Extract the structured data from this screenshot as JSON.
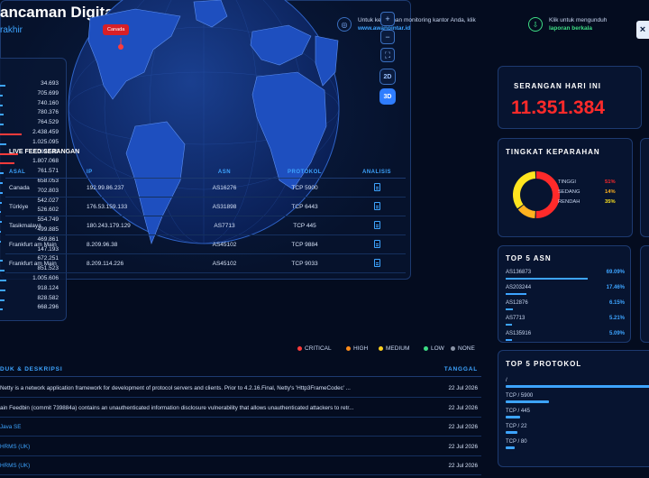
{
  "header": {
    "title": "ancaman Digital di Indonesia",
    "subtitle": "rakhir",
    "info1_text": "Untuk kebutuhan monitoring kantor Anda, klik",
    "info1_link": "www.awanpintar.id",
    "info2_text": "Klik untuk mengunduh",
    "info2_link": "laporan berkala"
  },
  "left_list": {
    "values": [
      "34.693",
      "705.699",
      "740.160",
      "780.376",
      "764.529",
      "2.438.459",
      "1.025.095",
      "2.092.529",
      "1.807.068",
      "761.571",
      "658.053",
      "702.803",
      "542.027",
      "526.602",
      "554.749",
      "499.885",
      "469.861",
      "147.193",
      "672.251",
      "851.523",
      "1.005.606",
      "918.124",
      "828.582",
      "668.296"
    ],
    "bars": [
      0.35,
      0.28,
      0.28,
      0.3,
      0.29,
      0.95,
      0.4,
      0.82,
      0.7,
      0.3,
      0.26,
      0.28,
      0.22,
      0.21,
      0.22,
      0.2,
      0.19,
      0.08,
      0.27,
      0.33,
      0.4,
      0.36,
      0.33,
      0.27
    ]
  },
  "map": {
    "marker_label": "Canada",
    "zoom_in": "+",
    "zoom_out": "−",
    "fullscreen": "⛶",
    "view_2d": "2D",
    "view_3d": "3D"
  },
  "feed": {
    "title": "LIVE FEED SERANGAN",
    "columns": [
      "ASAL",
      "IP",
      "ASN",
      "PROTOKOL",
      "ANALISIS"
    ],
    "rows": [
      [
        "Canada",
        "192.99.86.237",
        "AS16276",
        "TCP 5900"
      ],
      [
        "Türkiye",
        "176.53.159.133",
        "AS31898",
        "TCP 6443"
      ],
      [
        "Tasikmalaya",
        "180.243.179.129",
        "AS7713",
        "TCP 445"
      ],
      [
        "Frankfurt am Main",
        "8.209.96.38",
        "AS45102",
        "TCP 9884"
      ],
      [
        "Frankfurt am Main",
        "8.209.114.226",
        "AS45102",
        "TCP 9033"
      ]
    ]
  },
  "legend": [
    {
      "label": "CRITICAL",
      "color": "#ff3b3b"
    },
    {
      "label": "HIGH",
      "color": "#ff8c1a"
    },
    {
      "label": "MEDIUM",
      "color": "#ffd21f"
    },
    {
      "label": "LOW",
      "color": "#3ddc84"
    },
    {
      "label": "NONE",
      "color": "#8a94a6"
    }
  ],
  "vuln": {
    "col_product": "DUK & DESKRIPSI",
    "col_date": "TANGGAL",
    "rows": [
      {
        "text": "Netty is a network application framework for development of protocol servers and clients. Prior to 4.2.16.Final, Netty's 'Http3FrameCodec' ...",
        "date": "22 Jul 2026",
        "link": false
      },
      {
        "text": "ain    Feedbin (commit 739884a) contains an unauthenticated information disclosure vulnerability that allows unauthenticated attackers to retr...",
        "date": "22 Jul 2026",
        "link": false
      },
      {
        "text": "Java SE",
        "date": "22 Jul 2026",
        "link": true
      },
      {
        "text": "HRMS (UK)",
        "date": "22 Jul 2026",
        "link": true
      },
      {
        "text": "HRMS (UK)",
        "date": "22 Jul 2026",
        "link": true
      }
    ]
  },
  "attack_today": {
    "label": "SERANGAN HARI INI",
    "value": "11.351.384"
  },
  "severity": {
    "title": "TINGKAT KEPARAHAN",
    "items": [
      {
        "label": "TINGGI",
        "pct": "51%",
        "color": "#ff2a2a",
        "value": 51
      },
      {
        "label": "SEDANG",
        "pct": "14%",
        "color": "#ffb21f",
        "value": 14
      },
      {
        "label": "RENDAH",
        "pct": "35%",
        "color": "#ffe51f",
        "value": 35
      }
    ]
  },
  "top_asn": {
    "title": "TOP 5 ASN",
    "rows": [
      {
        "name": "AS136873",
        "pct": "69.09%",
        "value": 69.09
      },
      {
        "name": "AS203244",
        "pct": "17.46%",
        "value": 17.46
      },
      {
        "name": "AS12876",
        "pct": "6.15%",
        "value": 6.15
      },
      {
        "name": "AS7713",
        "pct": "5.21%",
        "value": 5.21
      },
      {
        "name": "AS135916",
        "pct": "5.09%",
        "value": 5.09
      }
    ]
  },
  "top_proto": {
    "title": "TOP 5 PROTOKOL",
    "rows": [
      {
        "name": "/",
        "value": 1.0
      },
      {
        "name": "TCP / 5900",
        "value": 0.3
      },
      {
        "name": "TCP / 445",
        "value": 0.1
      },
      {
        "name": "TCP / 22",
        "value": 0.08
      },
      {
        "name": "TCP / 80",
        "value": 0.06
      }
    ]
  },
  "close_label": "×"
}
